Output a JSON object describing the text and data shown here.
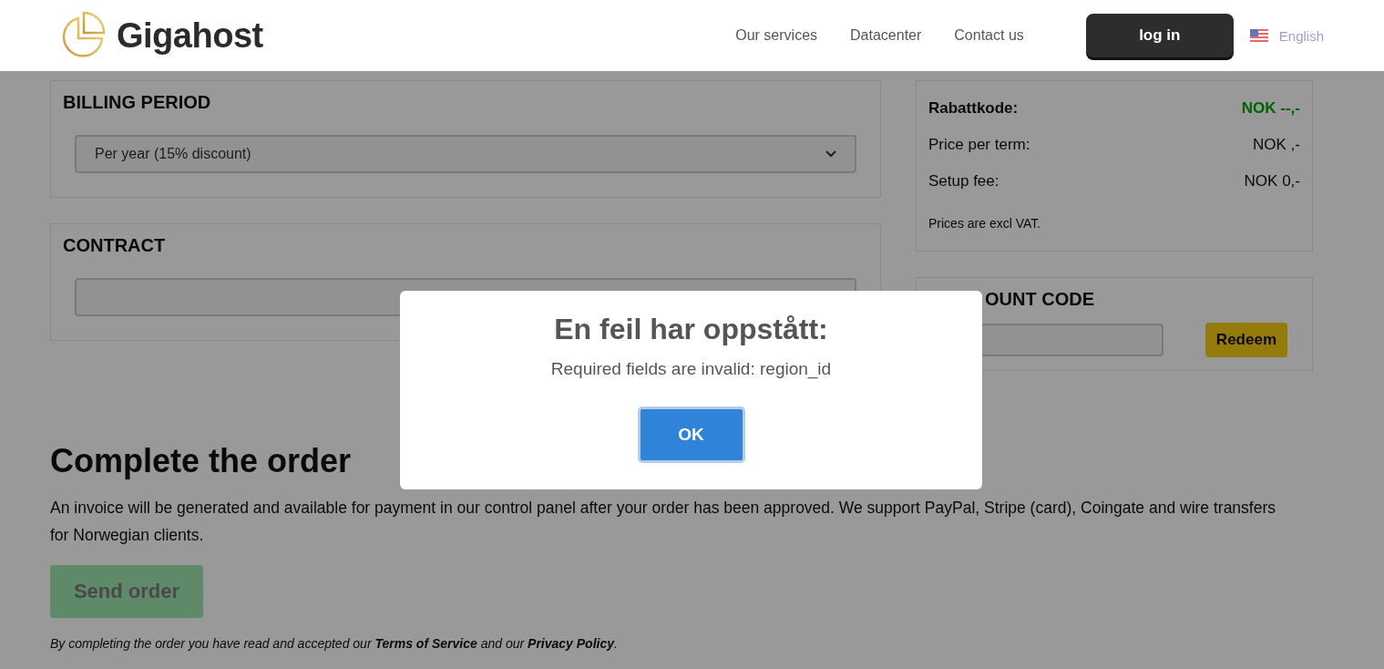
{
  "header": {
    "logo": "Gigahost",
    "nav": [
      "Our services",
      "Datacenter",
      "Contact us"
    ],
    "login": "log in",
    "language": "English"
  },
  "billing": {
    "title": "BILLING PERIOD",
    "value": "Per year (15% discount)"
  },
  "contract": {
    "title": "CONTRACT"
  },
  "summary": {
    "rows": [
      {
        "kind": "discount",
        "label": "Rabattkode:",
        "value": "NOK --,-"
      },
      {
        "kind": "price",
        "label": "Price per term:",
        "value": "NOK ,-"
      },
      {
        "kind": "price",
        "label": "Setup fee:",
        "value": "NOK 0,-"
      }
    ],
    "note": "Prices are excl VAT."
  },
  "discount": {
    "title": "OUNT CODE",
    "button": "Redeem"
  },
  "complete": {
    "title": "Complete the order",
    "text": "An invoice will be generated and available for payment in our control panel after your order has been approved. We support PayPal, Stripe (card), Coingate and wire transfers for Norwegian clients.",
    "button": "Send order",
    "terms_before": "By completing the order you have read and accepted our",
    "terms_link": "Terms of Service",
    "terms_middle": "and our",
    "privacy_link": "Privacy Policy",
    "terms_end": "."
  },
  "dialog": {
    "title": "En feil har oppstått:",
    "message": "Required fields are invalid: region_id",
    "button": "OK"
  }
}
